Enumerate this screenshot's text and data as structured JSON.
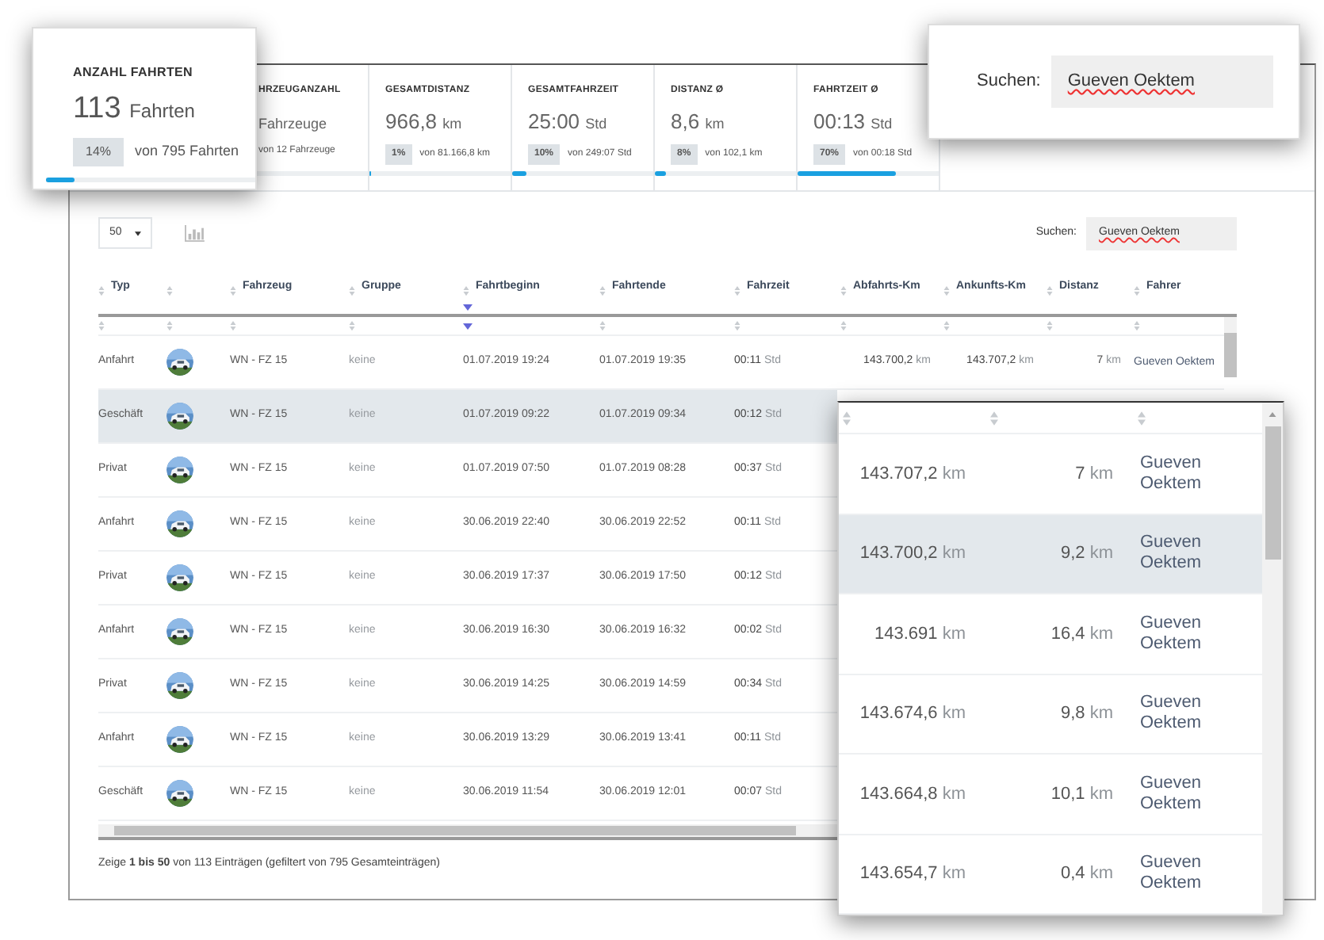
{
  "highlight_card": {
    "title": "ANZAHL FAHRTEN",
    "value": "113",
    "unit": "Fahrten",
    "badge": "14%",
    "note": "von 795 Fahrten",
    "level": 0.14
  },
  "stat_cards": [
    {
      "title": "HRZEUGANZAHL",
      "unit": "Fahrzeuge",
      "note": "von 12 Fahrzeuge"
    },
    {
      "title": "GESAMTDISTANZ",
      "value": "966,8",
      "unit": "km",
      "badge": "1%",
      "note": "von 81.166,8 km",
      "level": 0.01
    },
    {
      "title": "GESAMTFAHRZEIT",
      "value": "25:00",
      "unit": "Std",
      "badge": "10%",
      "note": "von 249:07 Std",
      "level": 0.1
    },
    {
      "title": "DISTANZ Ø",
      "value": "8,6",
      "unit": "km",
      "badge": "8%",
      "note": "von 102,1 km",
      "level": 0.08
    },
    {
      "title": "FAHRTZEIT Ø",
      "value": "00:13",
      "unit": "Std",
      "badge": "70%",
      "note": "von 00:18 Std",
      "level": 0.7
    }
  ],
  "page_size": "50",
  "search": {
    "label": "Suchen:",
    "value": "Gueven Oektem"
  },
  "search_zoom": {
    "label": "Suchen:",
    "value": "Gueven Oektem"
  },
  "table": {
    "columns": [
      {
        "label": "Typ",
        "sorted": false
      },
      {
        "sorted": false
      },
      {
        "label": "Fahrzeug",
        "sorted": false
      },
      {
        "label": "Gruppe",
        "sorted": false
      },
      {
        "label": "Fahrtbeginn",
        "sorted": true
      },
      {
        "label": "Fahrtende",
        "sorted": false
      },
      {
        "label": "Fahrzeit",
        "sorted": false
      },
      {
        "label": "Abfahrts-Km",
        "sorted": false
      },
      {
        "label": "Ankunfts-Km",
        "sorted": false
      },
      {
        "label": "Distanz",
        "sorted": false
      },
      {
        "label": "Fahrer",
        "sorted": false
      }
    ],
    "rows": [
      {
        "typ": "Anfahrt",
        "fahrzeug": "WN - FZ 15",
        "gruppe": "keine",
        "beginn": "01.07.2019 19:24",
        "ende": "01.07.2019 19:35",
        "fahrzeit": [
          "00:11",
          "Std"
        ],
        "abfahrt": [
          "143.700,2",
          "km"
        ],
        "ankunft": [
          "143.707,2",
          "km"
        ],
        "distanz": [
          "7",
          "km"
        ],
        "fahrer": "Gueven Oektem",
        "selected": false
      },
      {
        "typ": "Geschäft",
        "fahrzeug": "WN - FZ 15",
        "gruppe": "keine",
        "beginn": "01.07.2019 09:22",
        "ende": "01.07.2019 09:34",
        "fahrzeit": [
          "00:12",
          "Std"
        ],
        "selected": true
      },
      {
        "typ": "Privat",
        "fahrzeug": "WN - FZ 15",
        "gruppe": "keine",
        "beginn": "01.07.2019 07:50",
        "ende": "01.07.2019 08:28",
        "fahrzeit": [
          "00:37",
          "Std"
        ],
        "selected": false
      },
      {
        "typ": "Anfahrt",
        "fahrzeug": "WN - FZ 15",
        "gruppe": "keine",
        "beginn": "30.06.2019 22:40",
        "ende": "30.06.2019 22:52",
        "fahrzeit": [
          "00:11",
          "Std"
        ],
        "selected": false
      },
      {
        "typ": "Privat",
        "fahrzeug": "WN - FZ 15",
        "gruppe": "keine",
        "beginn": "30.06.2019 17:37",
        "ende": "30.06.2019 17:50",
        "fahrzeit": [
          "00:12",
          "Std"
        ],
        "selected": false
      },
      {
        "typ": "Anfahrt",
        "fahrzeug": "WN - FZ 15",
        "gruppe": "keine",
        "beginn": "30.06.2019 16:30",
        "ende": "30.06.2019 16:32",
        "fahrzeit": [
          "00:02",
          "Std"
        ],
        "selected": false
      },
      {
        "typ": "Privat",
        "fahrzeug": "WN - FZ 15",
        "gruppe": "keine",
        "beginn": "30.06.2019 14:25",
        "ende": "30.06.2019 14:59",
        "fahrzeit": [
          "00:34",
          "Std"
        ],
        "selected": false
      },
      {
        "typ": "Anfahrt",
        "fahrzeug": "WN - FZ 15",
        "gruppe": "keine",
        "beginn": "30.06.2019 13:29",
        "ende": "30.06.2019 13:41",
        "fahrzeit": [
          "00:11",
          "Std"
        ],
        "selected": false
      },
      {
        "typ": "Geschäft",
        "fahrzeug": "WN - FZ 15",
        "gruppe": "keine",
        "beginn": "30.06.2019 11:54",
        "ende": "30.06.2019 12:01",
        "fahrzeit": [
          "00:07",
          "Std"
        ],
        "selected": false
      }
    ]
  },
  "footer": "Zeige **1 bis 50** von 113 Einträgen (gefiltert von 795 Gesamteinträgen)",
  "table_zoom": {
    "rows": [
      {
        "ankunft": [
          "143.707,2",
          "km"
        ],
        "distanz": [
          "7",
          "km"
        ],
        "fahrer": "Gueven Oektem",
        "selected": false
      },
      {
        "ankunft": [
          "143.700,2",
          "km"
        ],
        "distanz": [
          "9,2",
          "km"
        ],
        "fahrer": "Gueven Oektem",
        "selected": true
      },
      {
        "ankunft": [
          "143.691",
          "km"
        ],
        "distanz": [
          "16,4",
          "km"
        ],
        "fahrer": "Gueven Oektem",
        "selected": false
      },
      {
        "ankunft": [
          "143.674,6",
          "km"
        ],
        "distanz": [
          "9,8",
          "km"
        ],
        "fahrer": "Gueven Oektem",
        "selected": false
      },
      {
        "ankunft": [
          "143.664,8",
          "km"
        ],
        "distanz": [
          "10,1",
          "km"
        ],
        "fahrer": "Gueven Oektem",
        "selected": false
      },
      {
        "ankunft": [
          "143.654,7",
          "km"
        ],
        "distanz": [
          "0,4",
          "km"
        ],
        "fahrer": "Gueven Oektem",
        "selected": false
      }
    ]
  }
}
